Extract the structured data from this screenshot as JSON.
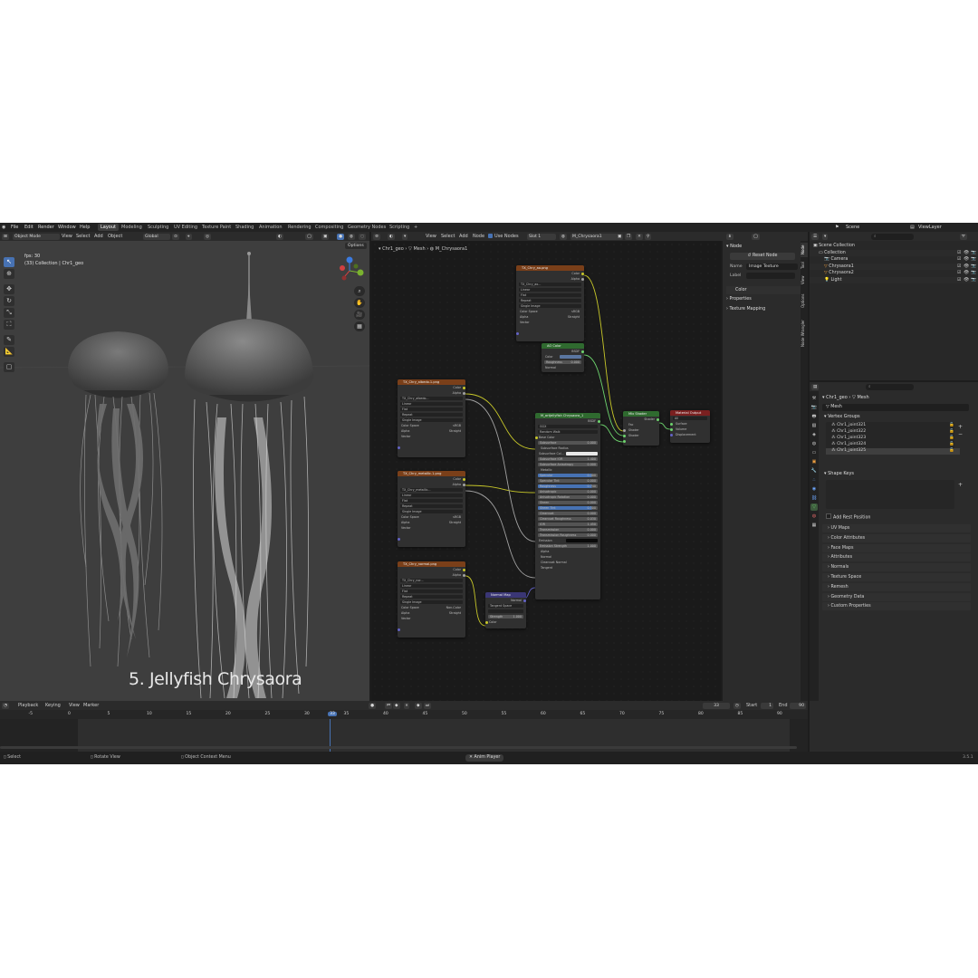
{
  "topbar": {
    "menus": [
      "File",
      "Edit",
      "Render",
      "Window",
      "Help"
    ],
    "workspaces": [
      "Layout",
      "Modeling",
      "Sculpting",
      "UV Editing",
      "Texture Paint",
      "Shading",
      "Animation",
      "Rendering",
      "Compositing",
      "Geometry Nodes",
      "Scripting"
    ],
    "active_workspace": "Layout",
    "add_tab": "+",
    "scene_label": "Scene",
    "view_layer_label": "ViewLayer"
  },
  "viewport": {
    "mode": "Object Mode",
    "menus": [
      "View",
      "Select",
      "Add",
      "Object"
    ],
    "orientation": "Global",
    "options_label": "Options",
    "fps": "fps: 30",
    "info_line": "(33) Collection | Chr1_geo",
    "caption": "5. Jellyfish Chrysaora",
    "axis_labels": {
      "x": "X",
      "y": "Y",
      "z": "Z"
    }
  },
  "node_editor": {
    "menus": [
      "View",
      "Select",
      "Add",
      "Node"
    ],
    "use_nodes": "Use Nodes",
    "slot": "Slot 1",
    "material": "M_Chrysaora1",
    "breadcrumb": [
      "Chr1_geo",
      "Mesh",
      "M_Chrysaora1"
    ],
    "nodes": {
      "tex_ao": {
        "title": "TX_Chry_ao.png",
        "image": "TX_Chry_ao...",
        "rows": [
          "Linear",
          "Flat",
          "Repeat",
          "Single Image"
        ],
        "color_space_label": "Color Space",
        "color_space": "sRGB",
        "alpha_label": "Alpha",
        "alpha": "Straight",
        "outputs": [
          "Color",
          "Alpha"
        ],
        "input": "Vector"
      },
      "ao_color": {
        "title": "AO Color",
        "output": "BSDF",
        "inputs": [
          "Color"
        ],
        "roughness_label": "Roughness",
        "roughness": "0.000",
        "normal": "Normal"
      },
      "tex_albedo": {
        "title": "TX_Chry_albedo.1.png",
        "image": "TX_Chry_albedo...",
        "rows": [
          "Linear",
          "Flat",
          "Repeat",
          "Single Image"
        ],
        "color_space_label": "Color Space",
        "color_space": "sRGB",
        "alpha_label": "Alpha",
        "alpha": "Straight",
        "outputs": [
          "Color",
          "Alpha"
        ],
        "input": "Vector"
      },
      "tex_metallic": {
        "title": "TX_Chry_metallic.1.png",
        "image": "TX_Chry_metallic...",
        "rows": [
          "Linear",
          "Flat",
          "Repeat",
          "Single Image"
        ],
        "color_space_label": "Color Space",
        "color_space": "sRGB",
        "alpha_label": "Alpha",
        "alpha": "Straight",
        "outputs": [
          "Color",
          "Alpha"
        ],
        "input": "Vector"
      },
      "tex_normal": {
        "title": "TX_Chry_normal.png",
        "image": "TX_Chry_nor...",
        "rows": [
          "Linear",
          "Flat",
          "Repeat",
          "Single Image"
        ],
        "color_space_label": "Color Space",
        "color_space": "Non-Color",
        "alpha_label": "Alpha",
        "alpha": "Straight",
        "outputs": [
          "Color",
          "Alpha"
        ],
        "input": "Vector"
      },
      "normal_map": {
        "title": "Normal Map",
        "output": "Normal",
        "space": "Tangent Space",
        "strength_label": "Strength",
        "strength": "1.000",
        "input": "Color"
      },
      "principled": {
        "title": "M_artjellyfish Chrysaora_1",
        "output": "BSDF",
        "distribution": "GGX",
        "subsurface_method": "Random Walk",
        "base_color": "Base Color",
        "rows": [
          {
            "label": "Subsurface",
            "value": "0.000"
          },
          {
            "label": "Subsurface Radius",
            "value": ""
          },
          {
            "label": "Subsurface Col...",
            "value": ""
          },
          {
            "label": "Subsurface IOR",
            "value": "1.400"
          },
          {
            "label": "Subsurface Anisotropy",
            "value": "0.000"
          },
          {
            "label": "Metallic",
            "value": ""
          },
          {
            "label": "Specular",
            "value": "0.400"
          },
          {
            "label": "Specular Tint",
            "value": "0.000"
          },
          {
            "label": "Roughness",
            "value": "0.740"
          },
          {
            "label": "Anisotropic",
            "value": "0.000"
          },
          {
            "label": "Anisotropic Rotation",
            "value": "0.000"
          },
          {
            "label": "Sheen",
            "value": "0.000"
          },
          {
            "label": "Sheen Tint",
            "value": "0.500"
          },
          {
            "label": "Clearcoat",
            "value": "0.000"
          },
          {
            "label": "Clearcoat Roughness",
            "value": "0.030"
          },
          {
            "label": "IOR",
            "value": "1.450"
          },
          {
            "label": "Transmission",
            "value": "0.000"
          },
          {
            "label": "Transmission Roughness",
            "value": "0.000"
          },
          {
            "label": "Emission",
            "value": ""
          },
          {
            "label": "Emission Strength",
            "value": "1.000"
          },
          {
            "label": "Alpha",
            "value": ""
          },
          {
            "label": "Normal",
            "value": ""
          },
          {
            "label": "Clearcoat Normal",
            "value": ""
          },
          {
            "label": "Tangent",
            "value": ""
          }
        ]
      },
      "mix_shader": {
        "title": "Mix Shader",
        "output": "Shader",
        "inputs": [
          "Fac",
          "Shader",
          "Shader"
        ]
      },
      "material_output": {
        "title": "Material Output",
        "target": "All",
        "inputs": [
          "Surface",
          "Volume",
          "Displacement"
        ]
      }
    }
  },
  "node_sidebar": {
    "panel_title": "Node",
    "reset_label": "Reset Node",
    "name_label": "Name",
    "name_value": "Image Texture",
    "label_label": "Label",
    "color_label": "Color",
    "properties_label": "Properties",
    "texture_mapping_label": "Texture Mapping",
    "tabs": [
      "Node",
      "Tool",
      "View",
      "Options",
      "Node Wrangler"
    ]
  },
  "outliner": {
    "search_placeholder": "",
    "rows": [
      {
        "label": "Scene Collection",
        "indent": 0
      },
      {
        "label": "Collection",
        "indent": 1
      },
      {
        "label": "Camera",
        "indent": 2
      },
      {
        "label": "Chrysaora1",
        "indent": 2
      },
      {
        "label": "Chrysaora2",
        "indent": 2
      },
      {
        "label": "Light",
        "indent": 2
      }
    ]
  },
  "properties": {
    "breadcrumb_object": "Chr1_geo",
    "breadcrumb_data": "Mesh",
    "mesh_name": "Mesh",
    "vertex_groups_label": "Vertex Groups",
    "vertex_groups": [
      "Chr1_joint321",
      "Chr1_joint322",
      "Chr1_joint323",
      "Chr1_joint324",
      "Chr1_joint325"
    ],
    "shape_keys_label": "Shape Keys",
    "add_rest_label": "Add Rest Position",
    "panels": [
      "UV Maps",
      "Color Attributes",
      "Face Maps",
      "Attributes",
      "Normals",
      "Texture Space",
      "Remesh",
      "Geometry Data",
      "Custom Properties"
    ]
  },
  "timeline": {
    "menus": [
      "Playback",
      "Keying",
      "View",
      "Marker"
    ],
    "current_frame": "33",
    "start_label": "Start",
    "start": "1",
    "end_label": "End",
    "end": "90",
    "ruler": [
      "-5",
      "0",
      "5",
      "10",
      "15",
      "20",
      "25",
      "30",
      "33",
      "35",
      "40",
      "45",
      "50",
      "55",
      "60",
      "65",
      "70",
      "75",
      "80",
      "85",
      "90"
    ]
  },
  "statusbar": {
    "select": "Select",
    "rotate": "Rotate View",
    "context": "Object Context Menu",
    "player": "Anim Player",
    "version": "3.5.1"
  },
  "colors": {
    "accent": "#4772b3",
    "texture_header": "#7a3f19",
    "shader_header": "#2f6a2f",
    "vector_header": "#3a3675"
  }
}
